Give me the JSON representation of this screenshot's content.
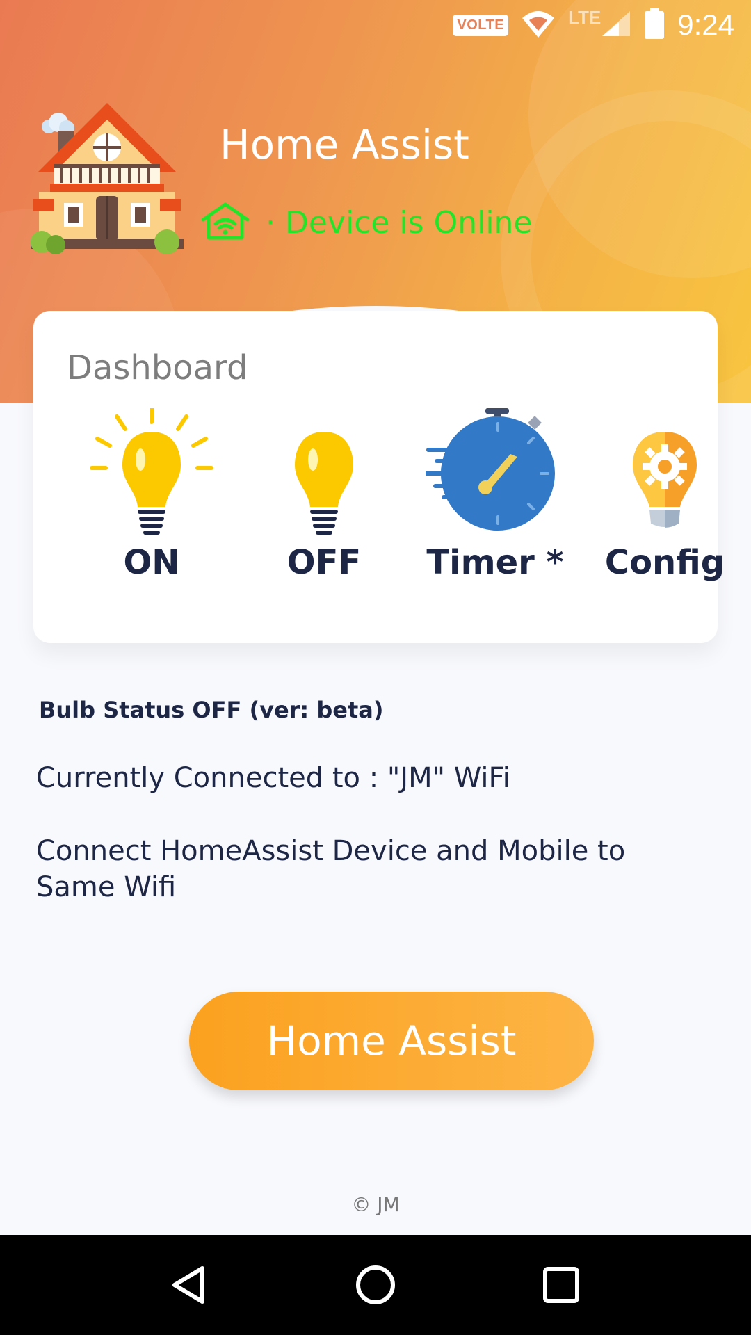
{
  "status_bar": {
    "volte": "VOLTE",
    "network": "LTE",
    "battery_level": "54",
    "time": "9:24"
  },
  "header": {
    "title": "Home Assist",
    "online_status": "· Device is Online",
    "online_color": "#22e52a"
  },
  "dashboard": {
    "title": "Dashboard",
    "items": [
      {
        "label": "ON",
        "icon": "bulb-on-icon"
      },
      {
        "label": "OFF",
        "icon": "bulb-off-icon"
      },
      {
        "label": "Timer *",
        "icon": "stopwatch-icon"
      },
      {
        "label": "Config",
        "icon": "bulb-gear-icon"
      }
    ]
  },
  "info": {
    "bulb_status": "Bulb Status OFF (ver: beta)",
    "connected": "Currently Connected to : \"JM\" WiFi",
    "hint": "Connect HomeAssist Device and Mobile to Same Wifi"
  },
  "cta": {
    "label": "Home Assist",
    "color": "#fba11f"
  },
  "footer": {
    "text": "© JM"
  },
  "nav": [
    "back-icon",
    "home-icon",
    "recents-icon"
  ]
}
